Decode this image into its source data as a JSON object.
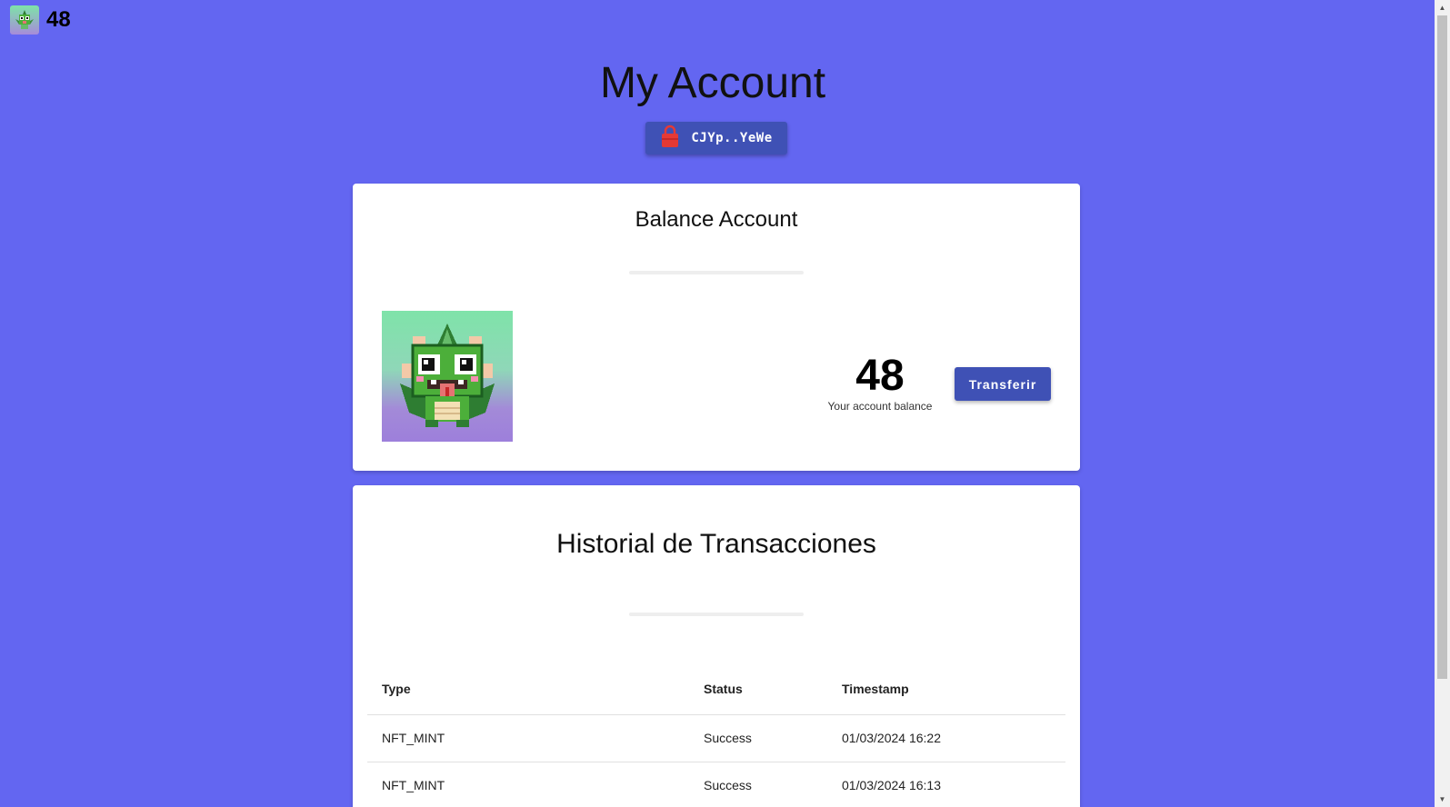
{
  "topbar": {
    "balance": "48",
    "avatar_icon": "dragon-avatar-icon"
  },
  "page": {
    "title": "My Account"
  },
  "wallet": {
    "address_short": "CJYp..YeWe",
    "icon": "wallet-lock-icon",
    "icon_color": "#e53935"
  },
  "balance_card": {
    "title": "Balance Account",
    "balance": "48",
    "caption": "Your account balance",
    "transfer_label": "Transferir"
  },
  "history_card": {
    "title": "Historial de Transacciones",
    "columns": [
      "Type",
      "Status",
      "Timestamp"
    ],
    "rows": [
      {
        "type": "NFT_MINT",
        "status": "Success",
        "timestamp": "01/03/2024 16:22"
      },
      {
        "type": "NFT_MINT",
        "status": "Success",
        "timestamp": "01/03/2024 16:13"
      }
    ]
  },
  "colors": {
    "background": "#6366f1",
    "primary_button": "#3f51b5",
    "card": "#ffffff"
  }
}
